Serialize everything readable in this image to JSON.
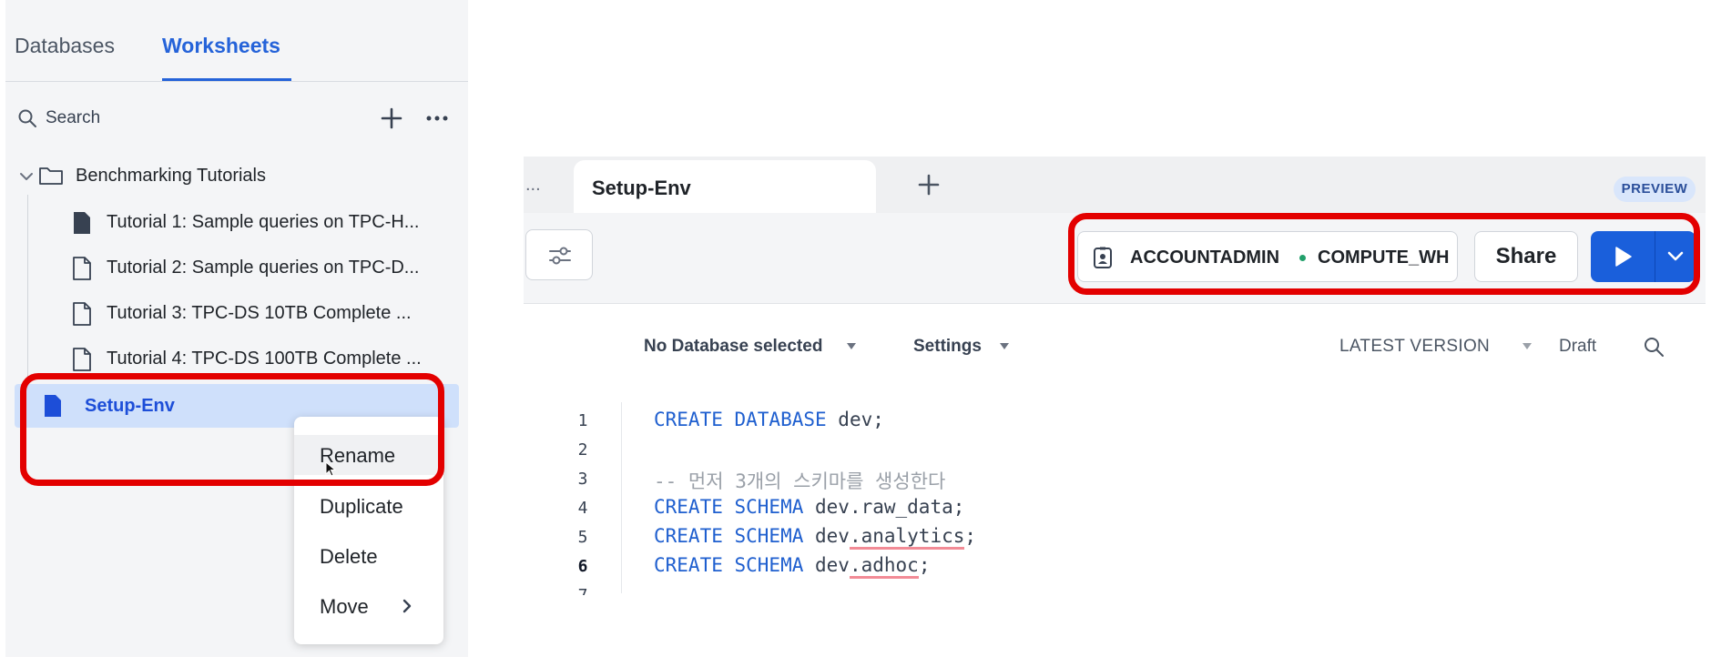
{
  "sidebar": {
    "tabs": {
      "databases": "Databases",
      "worksheets": "Worksheets"
    },
    "search_label": "Search",
    "folder": "Benchmarking Tutorials",
    "worksheets": [
      {
        "label": "Tutorial 1: Sample queries on TPC-H..."
      },
      {
        "label": "Tutorial 2: Sample queries on TPC-D..."
      },
      {
        "label": "Tutorial 3: TPC-DS 10TB Complete ..."
      },
      {
        "label": "Tutorial 4: TPC-DS 100TB Complete ..."
      }
    ],
    "active_worksheet": "Setup-Env",
    "context_menu": [
      "Rename",
      "Duplicate",
      "Delete",
      "Move"
    ]
  },
  "editor": {
    "tabs": {
      "overflow": "...",
      "active": "Setup-Env"
    },
    "preview_badge": "PREVIEW",
    "role": "ACCOUNTADMIN",
    "warehouse": "COMPUTE_WH",
    "share_label": "Share",
    "database_select": "No Database selected",
    "settings_select": "Settings",
    "version_label": "LATEST VERSION",
    "draft_label": "Draft",
    "line_numbers": [
      "1",
      "2",
      "3",
      "4",
      "5",
      "6",
      "7"
    ],
    "code": {
      "l1_kw": "CREATE DATABASE",
      "l1_rest": " dev;",
      "l3_comment": "-- 먼저 3개의 스키마를 생성한다",
      "l4_kw": "CREATE SCHEMA",
      "l4_rest": " dev.raw_data;",
      "l5_kw": "CREATE SCHEMA",
      "l5_a": " dev",
      "l5_b": ".analytics",
      "l5_c": ";",
      "l6_kw": "CREATE SCHEMA",
      "l6_a": " dev",
      "l6_b": ".adhoc",
      "l6_c": ";"
    }
  },
  "colors": {
    "accent": "#2563d9",
    "run_button": "#1a5fdb",
    "annotation": "#e30000",
    "warehouse_status": "#22a06b"
  }
}
